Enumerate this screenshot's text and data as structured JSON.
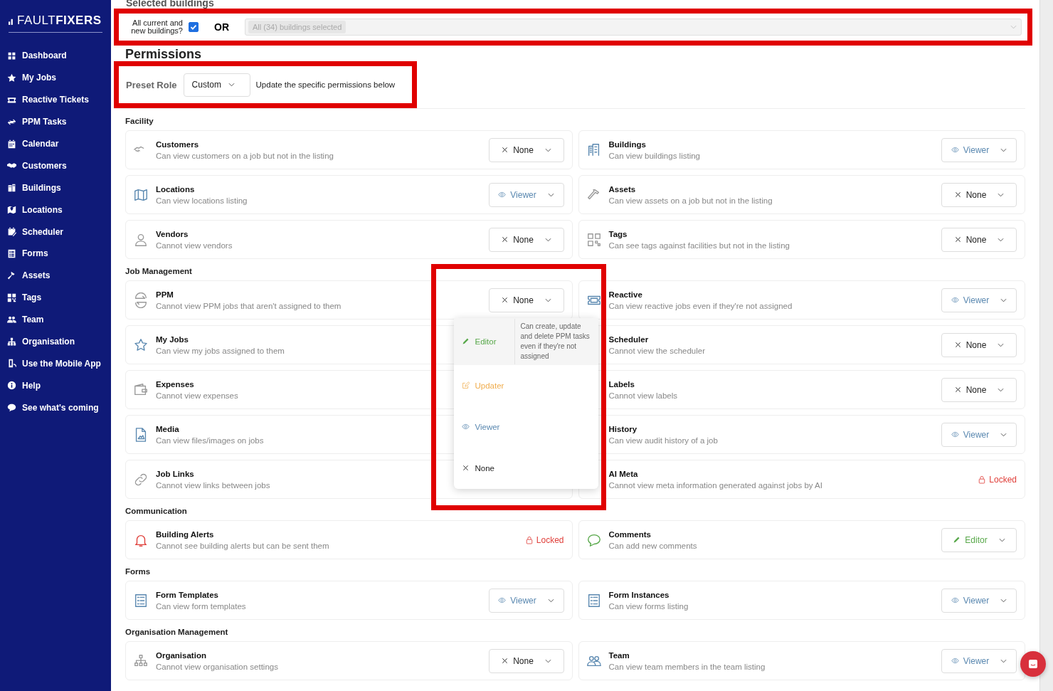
{
  "brand": {
    "prefix": "FAULT",
    "suffix": "FIXERS"
  },
  "sidebar": {
    "items": [
      {
        "label": "Dashboard"
      },
      {
        "label": "My Jobs"
      },
      {
        "label": "Reactive Tickets"
      },
      {
        "label": "PPM Tasks"
      },
      {
        "label": "Calendar"
      },
      {
        "label": "Customers"
      },
      {
        "label": "Buildings"
      },
      {
        "label": "Locations"
      },
      {
        "label": "Scheduler"
      },
      {
        "label": "Forms"
      },
      {
        "label": "Assets"
      },
      {
        "label": "Tags"
      },
      {
        "label": "Team"
      },
      {
        "label": "Organisation"
      },
      {
        "label": "Use the Mobile App"
      },
      {
        "label": "Help"
      },
      {
        "label": "See what's coming"
      }
    ]
  },
  "buildings": {
    "heading": "Selected buildings",
    "all_label": "All current and new buildings?",
    "all_checked": true,
    "or_label": "OR",
    "chip": "All (34) buildings selected"
  },
  "permissions": {
    "heading": "Permissions",
    "preset_label": "Preset Role",
    "preset_value": "Custom",
    "preset_hint": "Update the specific permissions below"
  },
  "sections": [
    {
      "title": "Facility",
      "items": [
        {
          "name": "Customers",
          "description": "Can view customers on a job but not in the listing",
          "access": {
            "kind": "none",
            "label": "None"
          }
        },
        {
          "name": "Buildings",
          "description": "Can view buildings listing",
          "access": {
            "kind": "viewer",
            "label": "Viewer"
          }
        },
        {
          "name": "Locations",
          "description": "Can view locations listing",
          "access": {
            "kind": "viewer",
            "label": "Viewer"
          }
        },
        {
          "name": "Assets",
          "description": "Can view assets on a job but not in the listing",
          "access": {
            "kind": "none",
            "label": "None"
          }
        },
        {
          "name": "Vendors",
          "description": "Cannot view vendors",
          "access": {
            "kind": "none",
            "label": "None"
          }
        },
        {
          "name": "Tags",
          "description": "Can see tags against facilities but not in the listing",
          "access": {
            "kind": "none",
            "label": "None"
          }
        }
      ]
    },
    {
      "title": "Job Management",
      "items": [
        {
          "name": "PPM",
          "description": "Cannot view PPM jobs that aren't assigned to them",
          "access": {
            "kind": "none",
            "label": "None"
          },
          "menu": [
            {
              "kind": "editor",
              "label": "Editor",
              "highlighted": true,
              "description": "Can create, update and delete PPM tasks even if they're not assigned"
            },
            {
              "kind": "updater",
              "label": "Updater",
              "highlighted": false
            },
            {
              "kind": "viewer",
              "label": "Viewer",
              "highlighted": false
            },
            {
              "kind": "none",
              "label": "None",
              "highlighted": false
            }
          ]
        },
        {
          "name": "Reactive",
          "description": "Can view reactive jobs even if they're not assigned",
          "access": {
            "kind": "viewer",
            "label": "Viewer"
          }
        },
        {
          "name": "My Jobs",
          "description": "Can view my jobs assigned to them"
        },
        {
          "name": "Scheduler",
          "description": "Cannot view the scheduler",
          "access": {
            "kind": "none",
            "label": "None"
          }
        },
        {
          "name": "Expenses",
          "description": "Cannot view expenses"
        },
        {
          "name": "Labels",
          "description": "Cannot view labels",
          "access": {
            "kind": "none",
            "label": "None"
          }
        },
        {
          "name": "Media",
          "description": "Can view files/images on jobs"
        },
        {
          "name": "History",
          "description": "Can view audit history of a job",
          "access": {
            "kind": "viewer",
            "label": "Viewer"
          }
        },
        {
          "name": "Job Links",
          "description": "Cannot view links between jobs"
        },
        {
          "name": "AI Meta",
          "description": "Cannot view meta information generated against jobs by AI",
          "access": {
            "kind": "locked",
            "label": "Locked"
          }
        }
      ]
    },
    {
      "title": "Communication",
      "items": [
        {
          "name": "Building Alerts",
          "description": "Cannot see building alerts but can be sent them",
          "access": {
            "kind": "locked",
            "label": "Locked"
          }
        },
        {
          "name": "Comments",
          "description": "Can add new comments",
          "access": {
            "kind": "editor",
            "label": "Editor"
          }
        }
      ]
    },
    {
      "title": "Forms",
      "items": [
        {
          "name": "Form Templates",
          "description": "Can view form templates",
          "access": {
            "kind": "viewer",
            "label": "Viewer"
          }
        },
        {
          "name": "Form Instances",
          "description": "Can view forms listing",
          "access": {
            "kind": "viewer",
            "label": "Viewer"
          }
        }
      ]
    },
    {
      "title": "Organisation Management",
      "items": [
        {
          "name": "Organisation",
          "description": "Cannot view organisation settings",
          "access": {
            "kind": "none",
            "label": "None"
          }
        },
        {
          "name": "Team",
          "description": "Can view team members in the team listing",
          "access": {
            "kind": "viewer",
            "label": "Viewer"
          }
        }
      ]
    }
  ]
}
